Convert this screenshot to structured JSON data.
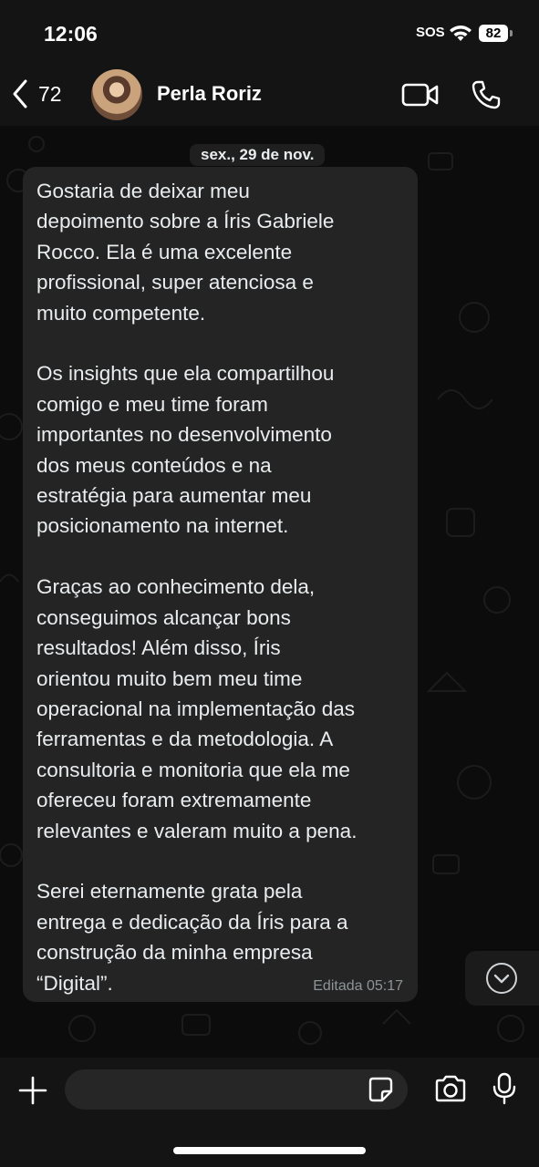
{
  "status": {
    "time": "12:06",
    "sos": "SOS",
    "battery": "82"
  },
  "header": {
    "back_count": "72",
    "contact_name": "Perla Roriz"
  },
  "chat": {
    "date": "sex., 29 de nov.",
    "message": {
      "text": "Gostaria de deixar meu\ndepoimento sobre a Íris Gabriele\nRocco. Ela é uma excelente\nprofissional, super atenciosa e\nmuito competente.\n\nOs insights que ela compartilhou\ncomigo e meu time foram\nimportantes no desenvolvimento\ndos meus conteúdos e na\nestratégia para aumentar meu\nposicionamento na internet.\n\nGraças ao conhecimento dela,\nconseguimos alcançar bons\nresultados! Além disso, Íris\norientou muito bem meu time\noperacional na implementação das\nferramentas e da metodologia. A\nconsultoria e monitoria que ela me\nofereceu foram extremamente\nrelevantes e valeram muito a pena.\n\nSerei eternamente grata pela\nentrega e dedicação da Íris para a\nconstrução da minha empresa\n“Digital”.",
      "meta": "Editada 05:17"
    }
  },
  "icons": {
    "back": "chevron-left-icon",
    "video": "video-camera-icon",
    "phone": "phone-icon",
    "scroll": "chevron-down-icon",
    "plus": "plus-icon",
    "sticker": "sticker-icon",
    "camera": "camera-icon",
    "mic": "microphone-icon"
  },
  "colors": {
    "bubble": "#242424",
    "background": "#0c0c0c",
    "bars": "#141414"
  }
}
